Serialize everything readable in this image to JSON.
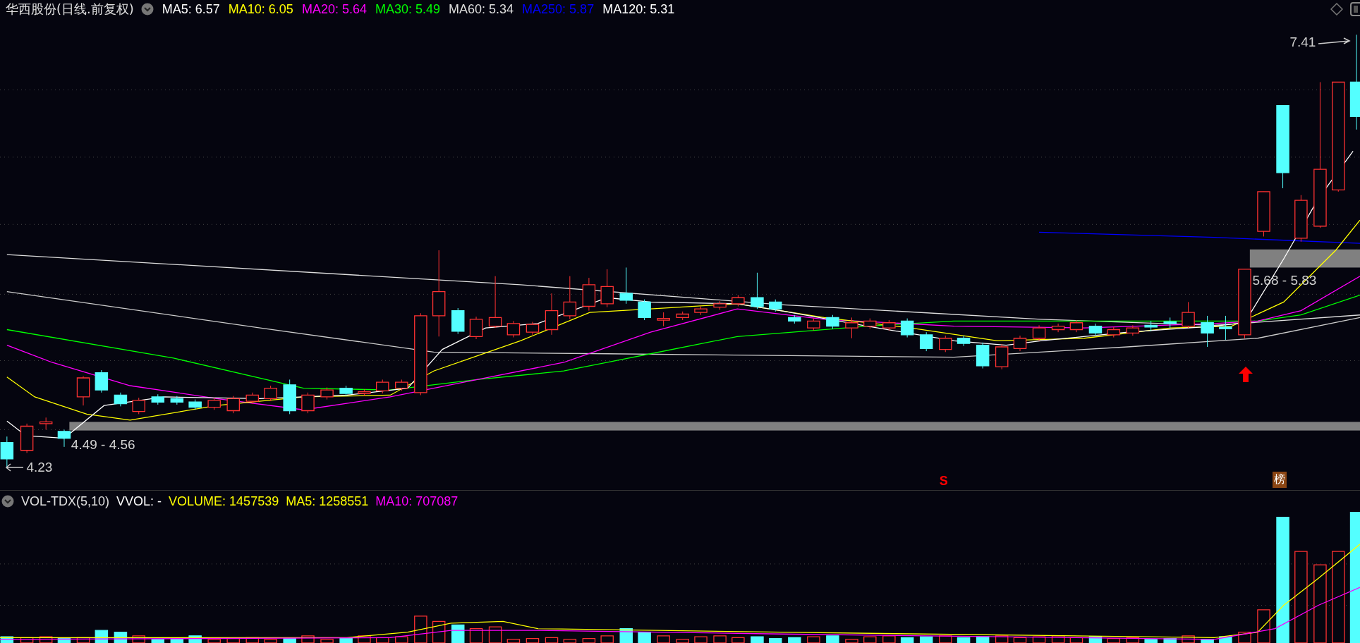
{
  "title": "华西股份(日线.前复权)",
  "indicators": [
    {
      "label": "MA5: 6.57",
      "color": "#ffffff"
    },
    {
      "label": "MA10: 6.05",
      "color": "#ffff00"
    },
    {
      "label": "MA20: 5.64",
      "color": "#ff00ff"
    },
    {
      "label": "MA30: 5.49",
      "color": "#00ff00"
    },
    {
      "label": "MA60: 5.34",
      "color": "#dddddd"
    },
    {
      "label": "MA250: 5.87",
      "color": "#0000ff"
    },
    {
      "label": "MA120: 5.31",
      "color": "#ffffff"
    }
  ],
  "annotations": [
    {
      "kind": "high",
      "text": "7.41"
    },
    {
      "kind": "range",
      "text": "5.68 - 5.83"
    },
    {
      "kind": "range",
      "text": "4.49 - 4.56"
    },
    {
      "kind": "low",
      "text": "4.23"
    }
  ],
  "markers": [
    {
      "kind": "signal",
      "text": "S"
    },
    {
      "kind": "badge",
      "text": "榜"
    },
    {
      "kind": "arrow"
    }
  ],
  "volume_header": {
    "name": "VOL-TDX(5,10)",
    "indicators": [
      {
        "label": "VVOL: -",
        "color": "#ffffff"
      },
      {
        "label": "VOLUME: 1457539",
        "color": "#ffff00"
      },
      {
        "label": "MA5: 1258551",
        "color": "#ffff00"
      },
      {
        "label": "MA10: 707087",
        "color": "#ff00ff"
      }
    ]
  }
}
